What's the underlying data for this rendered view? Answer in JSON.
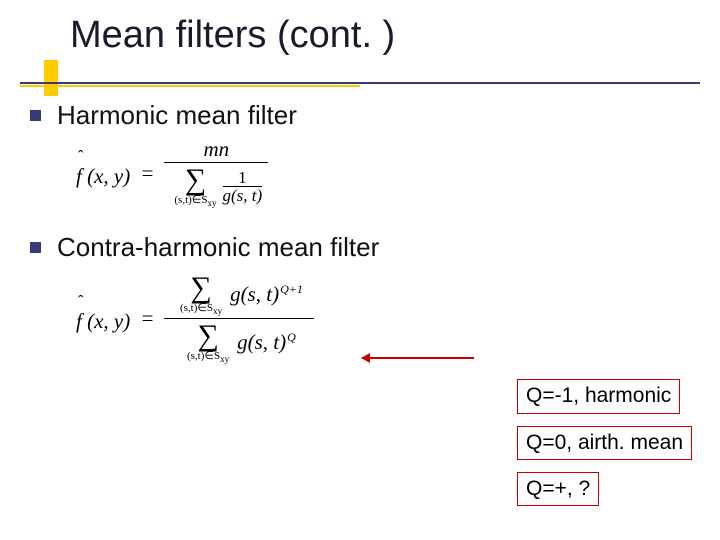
{
  "title": "Mean filters (cont. )",
  "bullets": [
    {
      "label": "Harmonic mean filter"
    },
    {
      "label": "Contra-harmonic mean filter"
    }
  ],
  "formula1": {
    "lhs": "f (x, y)",
    "eq": "=",
    "numerator": "mn",
    "inner_num": "1",
    "inner_den": "g(s, t)",
    "sum_sub": "(s,t)∈S",
    "sum_sub_suffix": "xy"
  },
  "formula2": {
    "lhs": "f (x, y)",
    "eq": "=",
    "g": "g(s, t)",
    "exp_top": "Q+1",
    "exp_bot": "Q",
    "sum_sub": "(s,t)∈S",
    "sum_sub_suffix": "xy"
  },
  "boxes": [
    "Q=-1, harmonic",
    "Q=0, airth. mean",
    "Q=+, ?"
  ]
}
